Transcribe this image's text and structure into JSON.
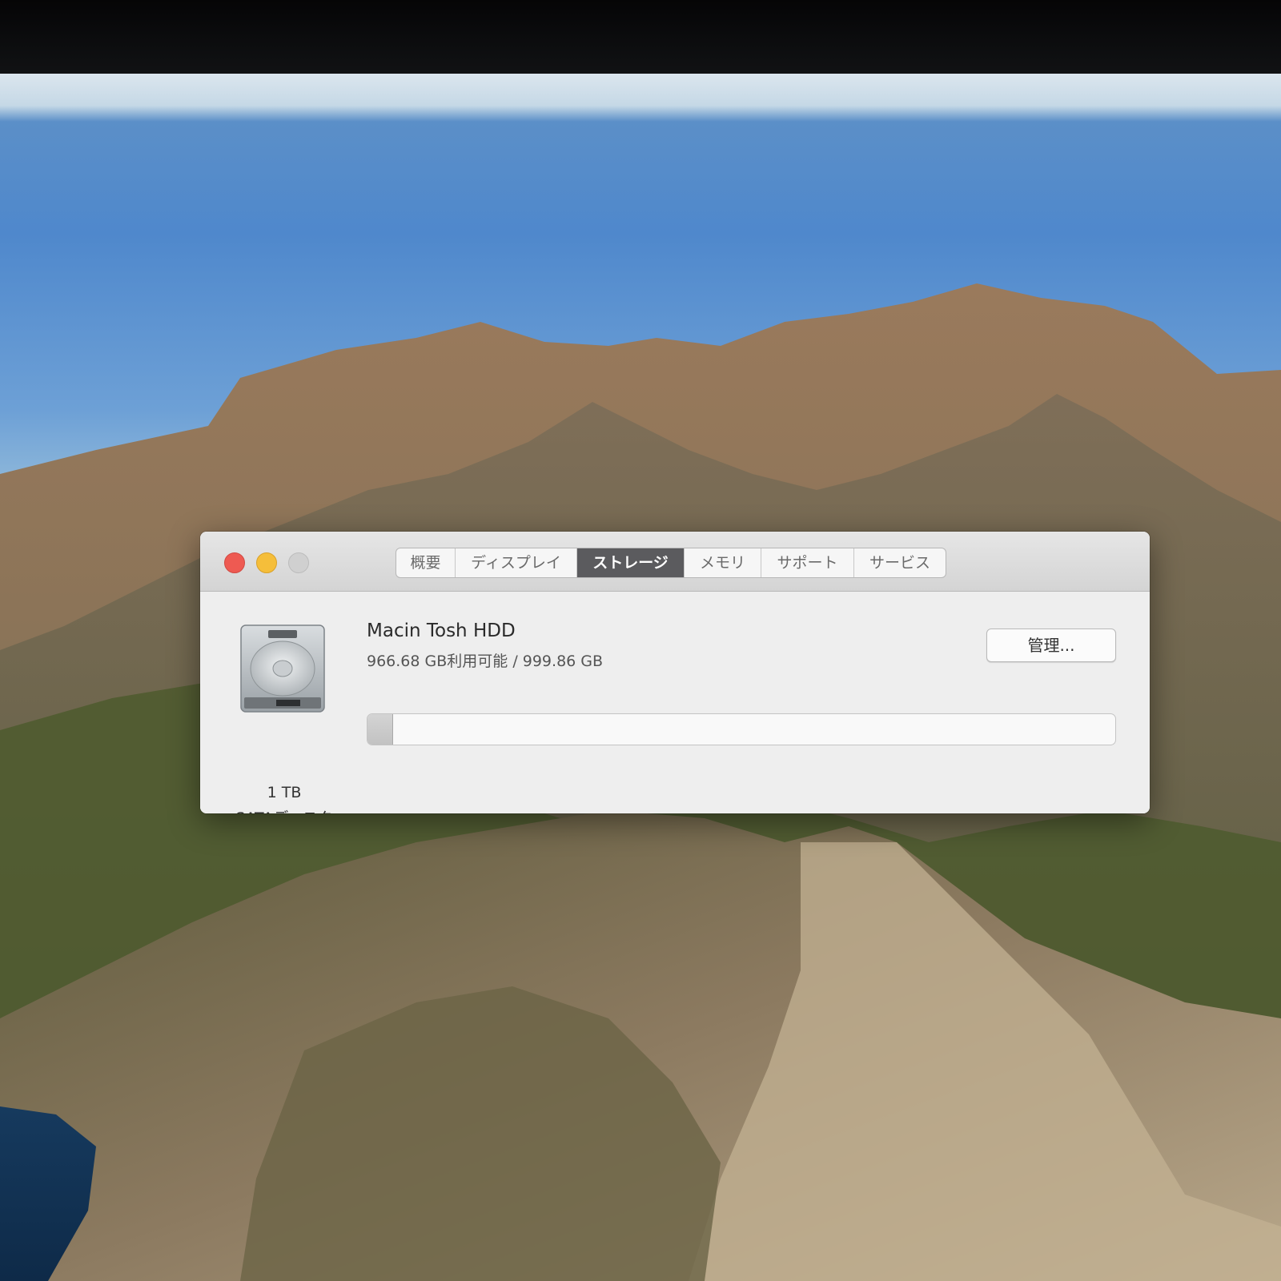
{
  "window": {
    "tabs": [
      {
        "label": "概要"
      },
      {
        "label": "ディスプレイ"
      },
      {
        "label": "ストレージ"
      },
      {
        "label": "メモリ"
      },
      {
        "label": "サポート"
      },
      {
        "label": "サービス"
      }
    ],
    "active_tab": "ストレージ"
  },
  "disk": {
    "icon": "hard-drive-icon",
    "size": "1 TB",
    "type": "SATAディスク"
  },
  "volume": {
    "name": "Macin Tosh HDD",
    "usage_text": "966.68 GB利用可能 / 999.86 GB",
    "used_fraction": 0.033,
    "manage_label": "管理..."
  },
  "colors": {
    "close": "#ee5a52",
    "minimize": "#f5be3a",
    "zoom_disabled": "#d0d0d0",
    "active_tab": "#5b5b5e"
  }
}
